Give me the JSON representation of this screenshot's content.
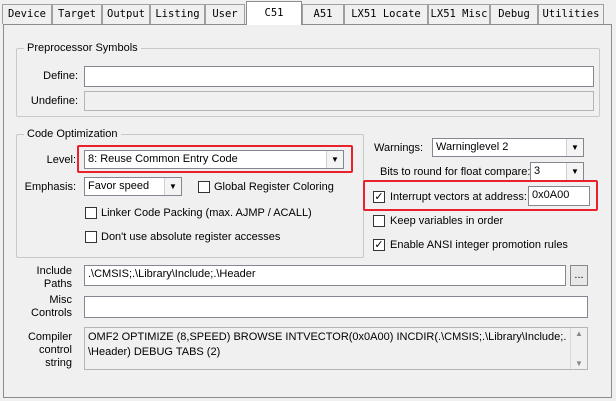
{
  "tabs": [
    {
      "label": "Device"
    },
    {
      "label": "Target"
    },
    {
      "label": "Output"
    },
    {
      "label": "Listing"
    },
    {
      "label": "User"
    },
    {
      "label": "C51"
    },
    {
      "label": "A51"
    },
    {
      "label": "LX51 Locate"
    },
    {
      "label": "LX51 Misc"
    },
    {
      "label": "Debug"
    },
    {
      "label": "Utilities"
    }
  ],
  "active_tab": "C51",
  "preprocessor": {
    "title": "Preprocessor Symbols",
    "define_label": "Define:",
    "define_value": "",
    "undefine_label": "Undefine:",
    "undefine_value": ""
  },
  "code_opt": {
    "title": "Code Optimization",
    "level_label": "Level:",
    "level_value": "8: Reuse Common Entry Code",
    "emphasis_label": "Emphasis:",
    "emphasis_value": "Favor speed",
    "global_register_label": "Global Register Coloring",
    "global_register_checked": false,
    "linker_packing_label": "Linker Code Packing (max. AJMP / ACALL)",
    "linker_packing_checked": false,
    "no_abs_register_label": "Don't use absolute register accesses",
    "no_abs_register_checked": false
  },
  "right": {
    "warnings_label": "Warnings:",
    "warnings_value": "Warninglevel 2",
    "bits_label": "Bits to round for float compare:",
    "bits_value": "3",
    "interrupt_label": "Interrupt vectors at address:",
    "interrupt_checked": true,
    "interrupt_value": "0x0A00",
    "keep_vars_label": "Keep variables in order",
    "keep_vars_checked": false,
    "ansi_label": "Enable ANSI integer promotion rules",
    "ansi_checked": true
  },
  "include": {
    "label_line1": "Include",
    "label_line2": "Paths",
    "value": ".\\CMSIS;.\\Library\\Include;.\\Header",
    "browse_label": "..."
  },
  "misc": {
    "label_line1": "Misc",
    "label_line2": "Controls",
    "value": ""
  },
  "compiler": {
    "label_line1": "Compiler",
    "label_line2": "control",
    "label_line3": "string",
    "line1": "OMF2 OPTIMIZE (8,SPEED) BROWSE INTVECTOR(0x0A00) INCDIR(.\\CMSIS;.\\Library\\Include;.",
    "line2": "\\Header) DEBUG TABS (2)"
  },
  "colors": {
    "highlight": "#e8212a",
    "background": "#f0f0f0"
  },
  "icons": {
    "check": "check-icon",
    "dropdown": "chevron-down-icon",
    "scroll_up": "scroll-up-icon",
    "scroll_down": "scroll-down-icon"
  }
}
